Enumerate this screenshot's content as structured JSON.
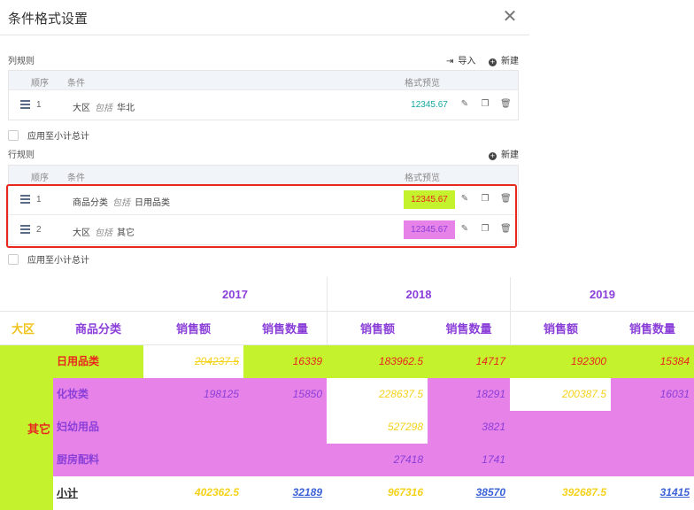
{
  "dialog": {
    "title": "条件格式设置",
    "close_label": "✕",
    "column_rules": {
      "label": "列规则",
      "import_label": "导入",
      "new_label": "新建",
      "headers": {
        "order": "顺序",
        "condition": "条件",
        "preview": "格式预览"
      },
      "rows": [
        {
          "num": "1",
          "field": "大区",
          "op": "包括",
          "value": "华北",
          "preview": "12345.67"
        }
      ],
      "apply_subtotal": "应用至小计总计"
    },
    "row_rules": {
      "label": "行规则",
      "new_label": "新建",
      "headers": {
        "order": "顺序",
        "condition": "条件",
        "preview": "格式预览"
      },
      "rows": [
        {
          "num": "1",
          "field": "商品分类",
          "op": "包括",
          "value": "日用品类",
          "preview": "12345.67"
        },
        {
          "num": "2",
          "field": "大区",
          "op": "包括",
          "value": "其它",
          "preview": "12345.67"
        }
      ],
      "apply_subtotal": "应用至小计总计"
    }
  },
  "colors": {
    "purple": "#e682e8",
    "lime": "#c4f22c",
    "red_text": "#e8281e",
    "yellow_text": "#f5d21a",
    "header_purple": "#8b3fd9",
    "teal": "#13a89e",
    "blue_link": "#3b62d6"
  },
  "pivot": {
    "years": [
      "2017",
      "2018",
      "2019"
    ],
    "row_headers": {
      "region": "大区",
      "category": "商品分类"
    },
    "measures": [
      "销售额",
      "销售数量"
    ],
    "region": "其它",
    "rows": [
      {
        "category": "日用品类",
        "values": [
          "204237.5",
          "16339",
          "183962.5",
          "14717",
          "192300",
          "15384"
        ]
      },
      {
        "category": "化妆类",
        "values": [
          "198125",
          "15850",
          "228637.5",
          "18291",
          "200387.5",
          "16031"
        ]
      },
      {
        "category": "妇幼用品",
        "values": [
          "",
          "",
          "527298",
          "3821",
          "",
          ""
        ]
      },
      {
        "category": "厨房配料",
        "values": [
          "",
          "",
          "27418",
          "1741",
          "",
          ""
        ]
      }
    ],
    "subtotal": {
      "label": "小计",
      "values": [
        "402362.5",
        "32189",
        "967316",
        "38570",
        "392687.5",
        "31415"
      ]
    }
  }
}
